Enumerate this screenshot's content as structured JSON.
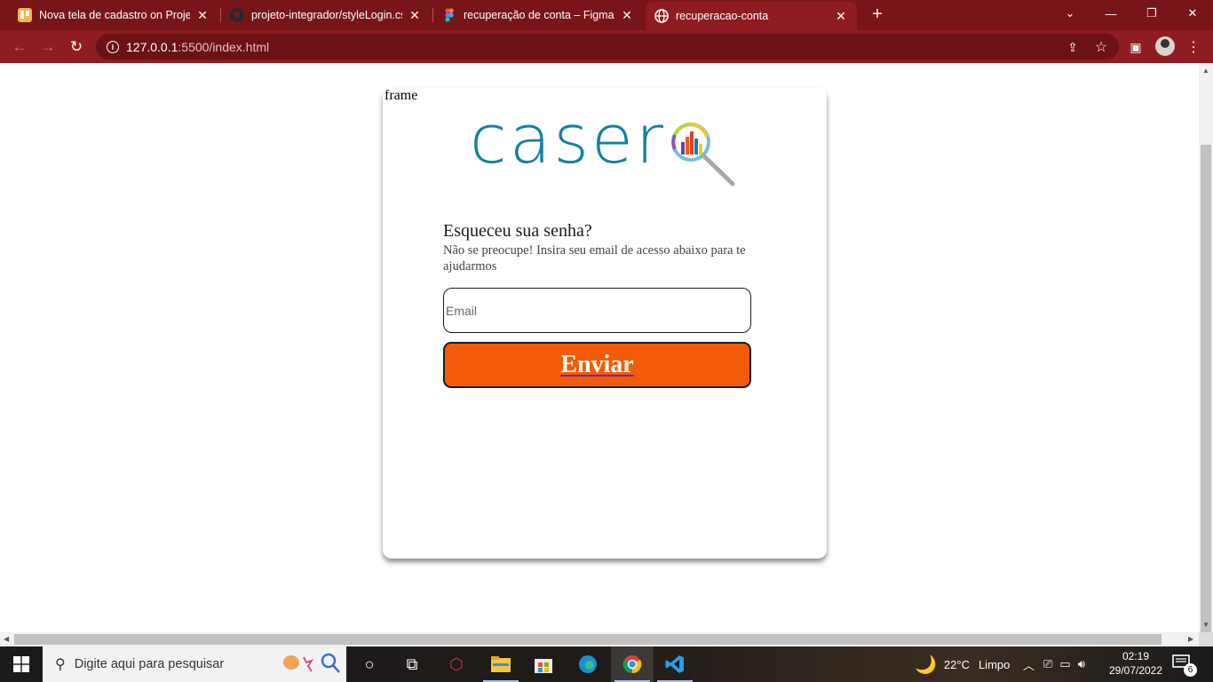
{
  "browser": {
    "tabs": [
      {
        "title": "Nova tela de cadastro on Projeto",
        "icon": "trello-icon",
        "active": false
      },
      {
        "title": "projeto-integrador/styleLogin.css",
        "icon": "github-icon",
        "active": false
      },
      {
        "title": "recuperação de conta – Figma",
        "icon": "figma-icon",
        "active": false
      },
      {
        "title": "recuperacao-conta",
        "icon": "globe-icon",
        "active": true
      }
    ],
    "url_host": "127.0.0.1",
    "url_path": ":5500/index.html"
  },
  "page": {
    "frame_label": "frame",
    "logo_text": "caser",
    "heading": "Esqueceu sua senha?",
    "subtext": "Não se preocupe! Insira seu email de acesso abaixo para te ajudarmos",
    "email_placeholder": "Email",
    "email_value": "",
    "submit_label": "Enviar",
    "colors": {
      "brand_blue": "#13809f",
      "button_orange": "#f45b06"
    }
  },
  "taskbar": {
    "search_placeholder": "Digite aqui para pesquisar",
    "weather_temp": "22°C",
    "weather_desc": "Limpo",
    "time": "02:19",
    "date": "29/07/2022",
    "notification_count": "6"
  }
}
